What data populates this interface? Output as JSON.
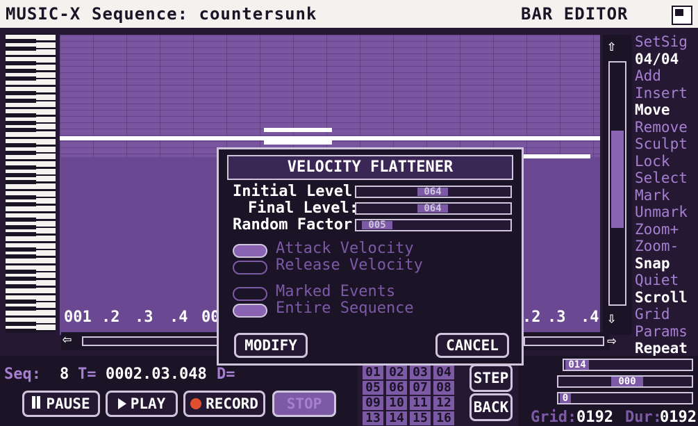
{
  "title": {
    "app": "MUSIC-X",
    "sequence": "Sequence: countersunk",
    "mode": "BAR EDITOR"
  },
  "ruler": {
    "left": [
      "001",
      ".2",
      ".3",
      ".4",
      "00"
    ],
    "right": [
      ".2",
      ".3",
      ".4"
    ]
  },
  "menu": [
    {
      "label": "SetSig",
      "active": false
    },
    {
      "label": "04/04",
      "active": true
    },
    {
      "label": "Add",
      "active": false
    },
    {
      "label": "Insert",
      "active": false
    },
    {
      "label": "Move",
      "active": true
    },
    {
      "label": "Remove",
      "active": false
    },
    {
      "label": "Sculpt",
      "active": false
    },
    {
      "label": "Lock",
      "active": false
    },
    {
      "label": "Select",
      "active": false
    },
    {
      "label": "Mark",
      "active": false
    },
    {
      "label": "Unmark",
      "active": false
    },
    {
      "label": "Zoom+",
      "active": false
    },
    {
      "label": "Zoom-",
      "active": false
    },
    {
      "label": "Snap",
      "active": true
    },
    {
      "label": "Quiet",
      "active": false
    },
    {
      "label": "Scroll",
      "active": true
    },
    {
      "label": "Grid",
      "active": false
    },
    {
      "label": "Params",
      "active": false
    },
    {
      "label": "Repeat",
      "active": true
    }
  ],
  "status": {
    "seq_label": "Seq:",
    "seq_value": "8",
    "time_label": "T=",
    "time_value": "0002.03.048",
    "d_label": "D="
  },
  "transport": {
    "pause": "PAUSE",
    "play": "PLAY",
    "record": "RECORD",
    "stop": "STOP"
  },
  "numbers": [
    "01",
    "02",
    "03",
    "04",
    "05",
    "06",
    "07",
    "08",
    "09",
    "10",
    "11",
    "12",
    "13",
    "14",
    "15",
    "16"
  ],
  "step_back": {
    "step": "STEP",
    "back": "BACK"
  },
  "right_panel": {
    "slider1": "014",
    "slider2": "000",
    "slider3": "0",
    "grid_label": "Grid:",
    "grid_value": "0192",
    "dur_label": "Dur:",
    "dur_value": "0192"
  },
  "dialog": {
    "title": "VELOCITY FLATTENER",
    "initial_label": "Initial Level:",
    "initial_value": "064",
    "final_label": "Final Level:",
    "final_value": "064",
    "random_label": "Random Factor:",
    "random_value": "005",
    "attack": "Attack Velocity",
    "release": "Release Velocity",
    "marked": "Marked Events",
    "entire": "Entire Sequence",
    "modify": "MODIFY",
    "cancel": "CANCEL"
  }
}
